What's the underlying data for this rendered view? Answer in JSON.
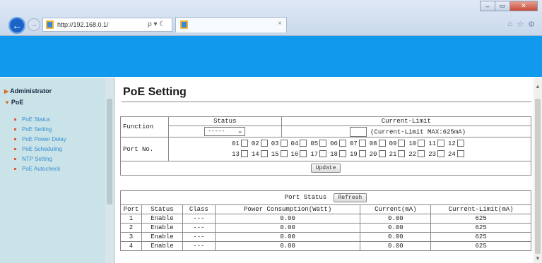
{
  "browser": {
    "url": "http://192.168.0.1/",
    "search_glyph": "ρ ▾ ☾",
    "tab_close": "×",
    "win_minimize": "‒",
    "win_maximize": "▭",
    "win_close": "✕",
    "toolbar_icons": [
      "home-icon",
      "star-icon",
      "gear-icon"
    ]
  },
  "sidebar": {
    "admin_label": "Administrator",
    "poe_label": "PoE",
    "items": [
      {
        "label": "PoE Status"
      },
      {
        "label": "PoE Setting"
      },
      {
        "label": "PoE Power Delay"
      },
      {
        "label": "PoE Scheduling"
      },
      {
        "label": "NTP Setting"
      },
      {
        "label": "PoE Autocheck"
      }
    ]
  },
  "main": {
    "title": "PoE Setting",
    "setting": {
      "function_label": "Function",
      "status_header": "Status",
      "current_limit_header": "Current-Limit",
      "status_selected": "-----",
      "current_limit_note": "(Current-Limit MAX:625mA)",
      "port_no_label": "Port No.",
      "ports_row1": [
        "01",
        "02",
        "03",
        "04",
        "05",
        "06",
        "07",
        "08",
        "09",
        "10",
        "11",
        "12"
      ],
      "ports_row2": [
        "13",
        "14",
        "15",
        "16",
        "17",
        "18",
        "19",
        "20",
        "21",
        "22",
        "23",
        "24"
      ],
      "update_button": "Update"
    },
    "port_status": {
      "label": "Port Status",
      "refresh_button": "Refresh",
      "columns": [
        "Port",
        "Status",
        "Class",
        "Power Consumption(Watt)",
        "Current(mA)",
        "Current-Limit(mA)"
      ],
      "rows": [
        [
          "1",
          "Enable",
          "---",
          "0.00",
          "0.00",
          "625"
        ],
        [
          "2",
          "Enable",
          "---",
          "0.00",
          "0.00",
          "625"
        ],
        [
          "3",
          "Enable",
          "---",
          "0.00",
          "0.00",
          "625"
        ],
        [
          "4",
          "Enable",
          "---",
          "0.00",
          "0.00",
          "625"
        ]
      ]
    }
  },
  "colors": {
    "banner": "#1199ee",
    "sidebar_bg": "#c9e3e8",
    "sidebar_link": "#3a8fd0"
  }
}
